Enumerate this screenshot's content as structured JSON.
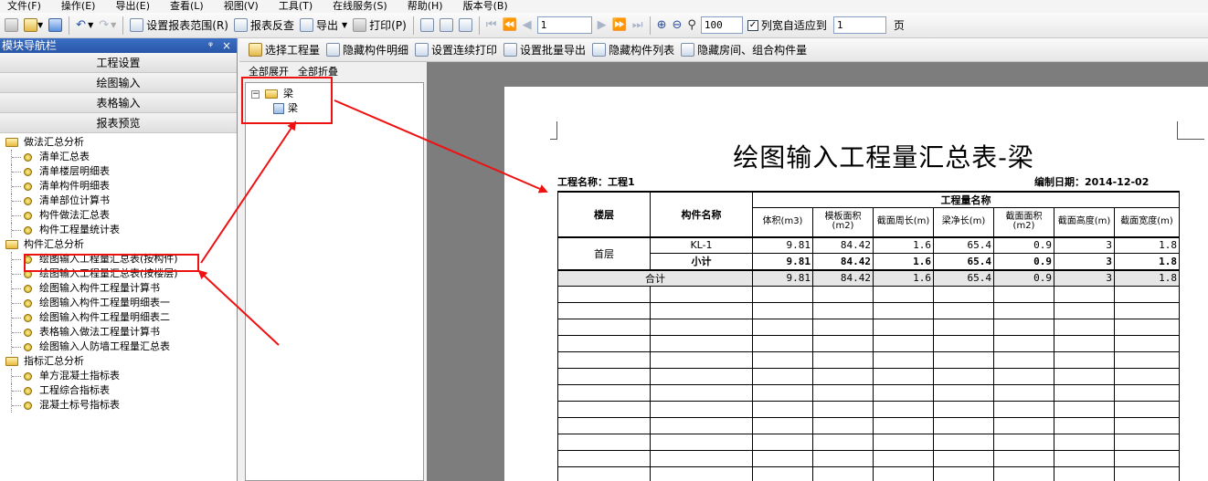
{
  "menu": [
    "文件(F)",
    "操作(E)",
    "导出(E)",
    "查看(L)",
    "视图(V)",
    "工具(T)",
    "在线服务(S)",
    "帮助(H)",
    "版本号(B)"
  ],
  "toolbar": {
    "set_range": "设置报表范围(R)",
    "report_check": "报表反查",
    "export": "导出",
    "print": "打印(P)",
    "page_input": "1",
    "zoom_input": "100",
    "fit_label": "列宽自适应到",
    "fit_input": "1",
    "page_unit": "页"
  },
  "left_panel": {
    "title": "模块导航栏",
    "pin": "ᵠ",
    "close": "×",
    "nav_buttons": [
      "工程设置",
      "绘图输入",
      "表格输入",
      "报表预览"
    ],
    "tree": [
      {
        "type": "folder",
        "label": "做法汇总分析"
      },
      {
        "type": "leaf",
        "label": "清单汇总表"
      },
      {
        "type": "leaf",
        "label": "清单楼层明细表"
      },
      {
        "type": "leaf",
        "label": "清单构件明细表"
      },
      {
        "type": "leaf",
        "label": "清单部位计算书"
      },
      {
        "type": "leaf",
        "label": "构件做法汇总表"
      },
      {
        "type": "leaf",
        "label": "构件工程量统计表"
      },
      {
        "type": "folder",
        "label": "构件汇总分析"
      },
      {
        "type": "leaf",
        "label": "绘图输入工程量汇总表(按构件)"
      },
      {
        "type": "leaf",
        "label": "绘图输入工程量汇总表(按楼层)"
      },
      {
        "type": "leaf",
        "label": "绘图输入构件工程量计算书"
      },
      {
        "type": "leaf",
        "label": "绘图输入构件工程量明细表一"
      },
      {
        "type": "leaf",
        "label": "绘图输入构件工程量明细表二"
      },
      {
        "type": "leaf",
        "label": "表格输入做法工程量计算书"
      },
      {
        "type": "leaf",
        "label": "绘图输入人防墙工程量汇总表"
      },
      {
        "type": "folder",
        "label": "指标汇总分析"
      },
      {
        "type": "leaf",
        "label": "单方混凝土指标表"
      },
      {
        "type": "leaf",
        "label": "工程综合指标表"
      },
      {
        "type": "leaf",
        "label": "混凝土标号指标表"
      }
    ]
  },
  "report_toolbar": [
    "选择工程量",
    "隐藏构件明细",
    "设置连续打印",
    "设置批量导出",
    "隐藏构件列表",
    "隐藏房间、组合构件量"
  ],
  "middle_panel": {
    "expand_all": "全部展开",
    "collapse_all": "全部折叠",
    "tree_root": "梁",
    "tree_child": "梁"
  },
  "report": {
    "title": "绘图输入工程量汇总表-梁",
    "project_name": "工程名称：工程1",
    "compile_date": "编制日期：2014-12-02",
    "headers": {
      "floor": "楼层",
      "component": "构件名称",
      "group": "工程量名称",
      "cols": [
        "体积(m3)",
        "模板面积(m2)",
        "截面周长(m)",
        "梁净长(m)",
        "截面面积(m2)",
        "截面高度(m)",
        "截面宽度(m)"
      ]
    },
    "rows": [
      {
        "floor": "首层",
        "component": "KL-1",
        "values": [
          "9.81",
          "84.42",
          "1.6",
          "65.4",
          "0.9",
          "3",
          "1.8"
        ]
      },
      {
        "floor": "",
        "component": "小计",
        "values": [
          "9.81",
          "84.42",
          "1.6",
          "65.4",
          "0.9",
          "3",
          "1.8"
        ]
      }
    ],
    "total": {
      "label": "合计",
      "values": [
        "9.81",
        "84.42",
        "1.6",
        "65.4",
        "0.9",
        "3",
        "1.8"
      ]
    }
  }
}
